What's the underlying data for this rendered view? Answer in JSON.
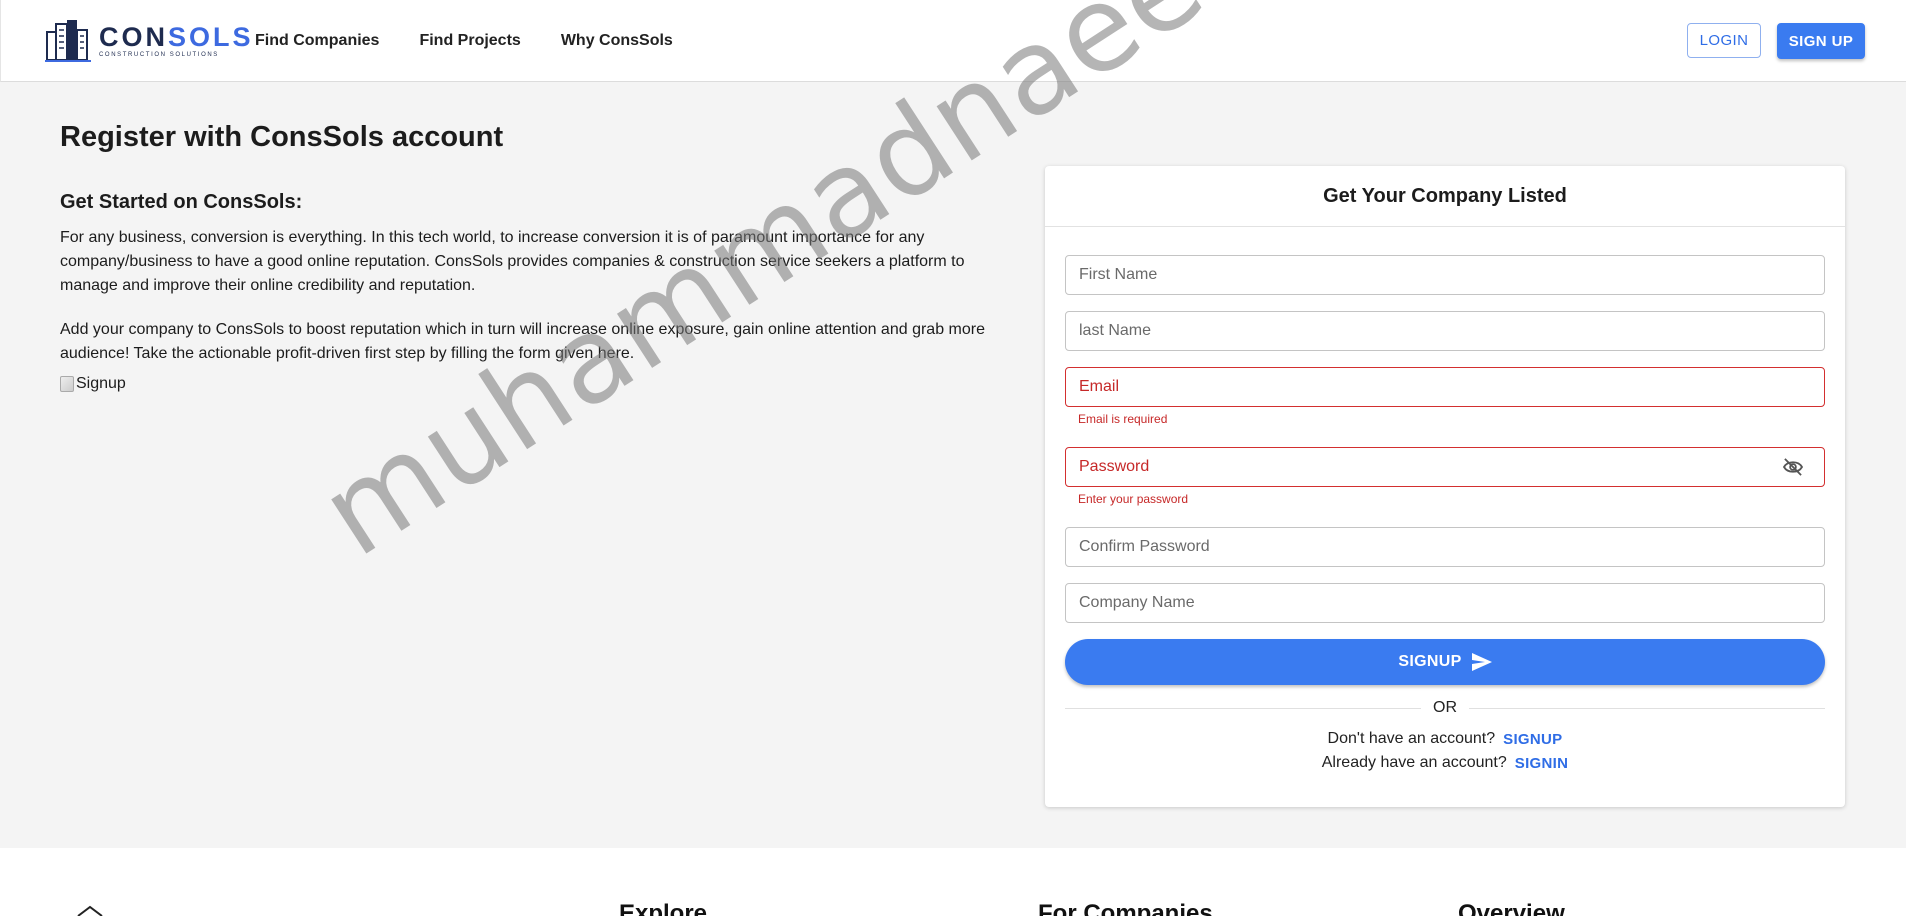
{
  "header": {
    "logo": {
      "word_a": "CON",
      "word_b": "SOLS",
      "tagline": "CONSTRUCTION SOLUTIONS"
    },
    "nav": [
      {
        "label": "Find Companies"
      },
      {
        "label": "Find Projects"
      },
      {
        "label": "Why ConsSols"
      }
    ],
    "login_label": "LOGIN",
    "signup_label": "SIGN UP"
  },
  "main": {
    "title": "Register with ConsSols account",
    "subtitle": "Get Started on ConsSols:",
    "paragraph1": "For any business, conversion is everything. In this tech world, to increase conversion it is of paramount importance for any company/business to have a good online reputation. ConsSols provides companies & construction service seekers a platform to manage and improve their online credibility and reputation.",
    "paragraph2": "Add your company to ConsSols to boost reputation which in turn will increase online exposure, gain online attention and grab more audience! Take the actionable profit-driven first step by filling the form given here.",
    "image_alt": "Signup"
  },
  "form": {
    "title": "Get Your Company Listed",
    "first_name": "First Name",
    "last_name": "last Name",
    "email": "Email",
    "email_error": "Email is required",
    "password": "Password",
    "password_error": "Enter your password",
    "confirm_password": "Confirm Password",
    "company_name": "Company Name",
    "submit_label": "SIGNUP",
    "or_label": "OR",
    "no_account_text": "Don't have an account?",
    "signup_link": "SIGNUP",
    "have_account_text": "Already have an account?",
    "signin_link": "SIGNIN"
  },
  "footer": {
    "explore": "Explore",
    "for_companies": "For Companies",
    "overview": "Overview"
  },
  "watermark": "muhammadnaeem.me",
  "colors": {
    "accent": "#3a7bf0",
    "error": "#d32f2f",
    "navy": "#1e2b4f"
  }
}
